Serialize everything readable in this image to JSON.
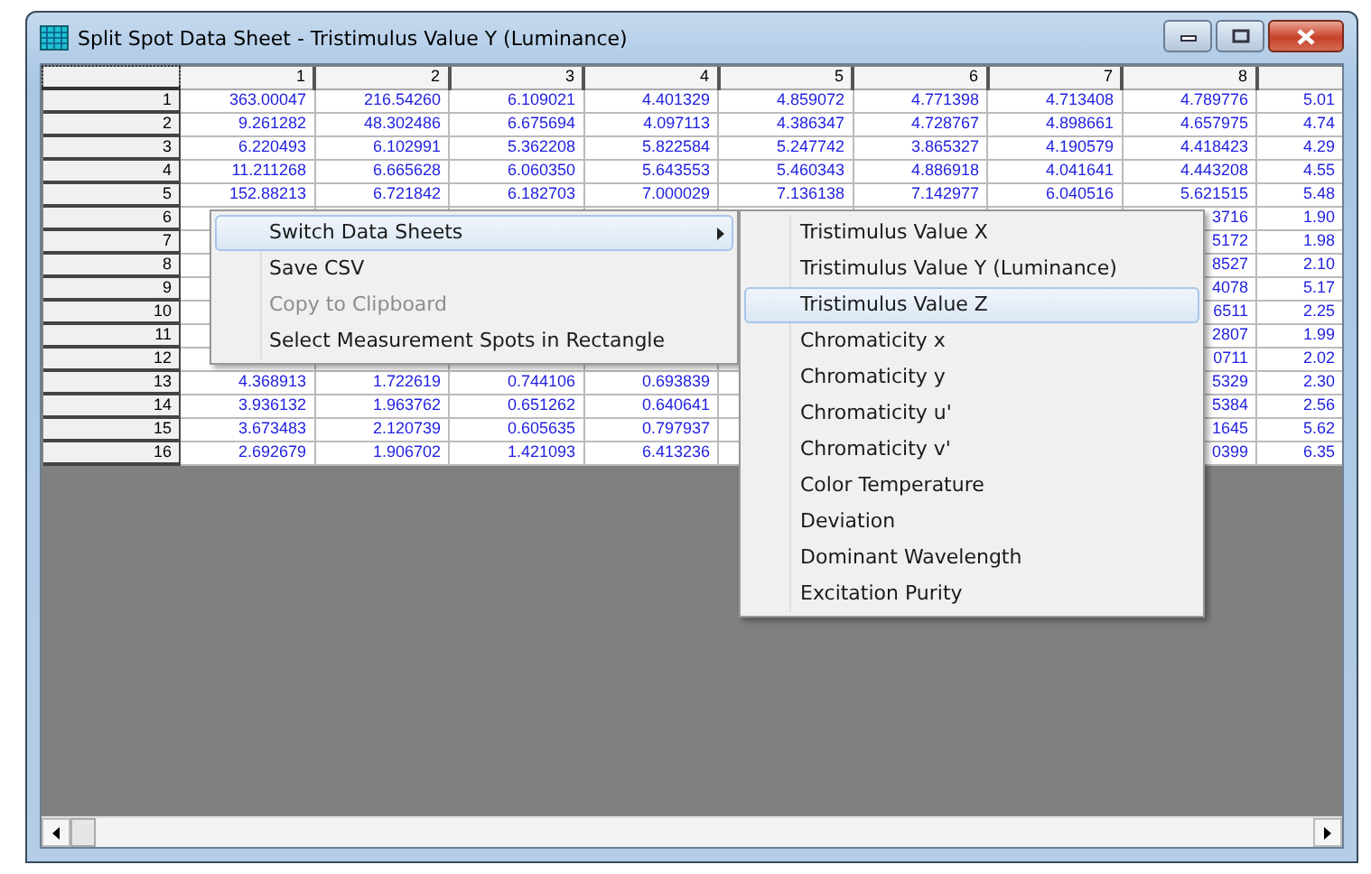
{
  "window": {
    "title": "Split Spot Data Sheet - Tristimulus Value Y (Luminance)"
  },
  "table": {
    "columns": [
      "1",
      "2",
      "3",
      "4",
      "5",
      "6",
      "7",
      "8"
    ],
    "rows": [
      {
        "header": "1",
        "cells": [
          "363.00047",
          "216.54260",
          "6.109021",
          "4.401329",
          "4.859072",
          "4.771398",
          "4.713408",
          "4.789776",
          "5.01"
        ]
      },
      {
        "header": "2",
        "cells": [
          "9.261282",
          "48.302486",
          "6.675694",
          "4.097113",
          "4.386347",
          "4.728767",
          "4.898661",
          "4.657975",
          "4.74"
        ]
      },
      {
        "header": "3",
        "cells": [
          "6.220493",
          "6.102991",
          "5.362208",
          "5.822584",
          "5.247742",
          "3.865327",
          "4.190579",
          "4.418423",
          "4.29"
        ]
      },
      {
        "header": "4",
        "cells": [
          "11.211268",
          "6.665628",
          "6.060350",
          "5.643553",
          "5.460343",
          "4.886918",
          "4.041641",
          "4.443208",
          "4.55"
        ]
      },
      {
        "header": "5",
        "cells": [
          "152.88213",
          "6.721842",
          "6.182703",
          "7.000029",
          "7.136138",
          "7.142977",
          "6.040516",
          "5.621515",
          "5.48"
        ]
      },
      {
        "header": "6",
        "cells": [
          null,
          null,
          null,
          null,
          null,
          null,
          null,
          "3716",
          "1.90"
        ]
      },
      {
        "header": "7",
        "cells": [
          null,
          null,
          null,
          null,
          null,
          null,
          null,
          "5172",
          "1.98"
        ]
      },
      {
        "header": "8",
        "cells": [
          null,
          null,
          null,
          null,
          null,
          null,
          null,
          "8527",
          "2.10"
        ]
      },
      {
        "header": "9",
        "cells": [
          null,
          null,
          null,
          null,
          null,
          null,
          null,
          "4078",
          "5.17"
        ]
      },
      {
        "header": "10",
        "cells": [
          null,
          null,
          null,
          null,
          null,
          null,
          null,
          "6511",
          "2.25"
        ]
      },
      {
        "header": "11",
        "cells": [
          null,
          null,
          null,
          null,
          null,
          null,
          null,
          "2807",
          "1.99"
        ]
      },
      {
        "header": "12",
        "cells": [
          null,
          null,
          null,
          null,
          null,
          null,
          null,
          "0711",
          "2.02"
        ]
      },
      {
        "header": "13",
        "cells": [
          "4.368913",
          "1.722619",
          "0.744106",
          "0.693839",
          null,
          null,
          null,
          "5329",
          "2.30"
        ]
      },
      {
        "header": "14",
        "cells": [
          "3.936132",
          "1.963762",
          "0.651262",
          "0.640641",
          null,
          null,
          null,
          "5384",
          "2.56"
        ]
      },
      {
        "header": "15",
        "cells": [
          "3.673483",
          "2.120739",
          "0.605635",
          "0.797937",
          null,
          null,
          null,
          "1645",
          "5.62"
        ]
      },
      {
        "header": "16",
        "cells": [
          "2.692679",
          "1.906702",
          "1.421093",
          "6.413236",
          null,
          null,
          null,
          "0399",
          "6.35"
        ]
      }
    ]
  },
  "context_menu": {
    "items": [
      {
        "label": "Switch Data Sheets",
        "selected": true,
        "disabled": false,
        "has_submenu": true
      },
      {
        "label": "Save CSV",
        "selected": false,
        "disabled": false,
        "has_submenu": false
      },
      {
        "label": "Copy to Clipboard",
        "selected": false,
        "disabled": true,
        "has_submenu": false
      },
      {
        "label": "Select Measurement Spots in Rectangle",
        "selected": false,
        "disabled": false,
        "has_submenu": false
      }
    ]
  },
  "submenu": {
    "items": [
      {
        "label": "Tristimulus Value X",
        "selected": false
      },
      {
        "label": "Tristimulus Value Y (Luminance)",
        "selected": false
      },
      {
        "label": "Tristimulus Value Z",
        "selected": true
      },
      {
        "label": "Chromaticity x",
        "selected": false
      },
      {
        "label": "Chromaticity y",
        "selected": false
      },
      {
        "label": "Chromaticity u'",
        "selected": false
      },
      {
        "label": "Chromaticity v'",
        "selected": false
      },
      {
        "label": "Color Temperature",
        "selected": false
      },
      {
        "label": "Deviation",
        "selected": false
      },
      {
        "label": "Dominant Wavelength",
        "selected": false
      },
      {
        "label": "Excitation Purity",
        "selected": false
      }
    ]
  }
}
